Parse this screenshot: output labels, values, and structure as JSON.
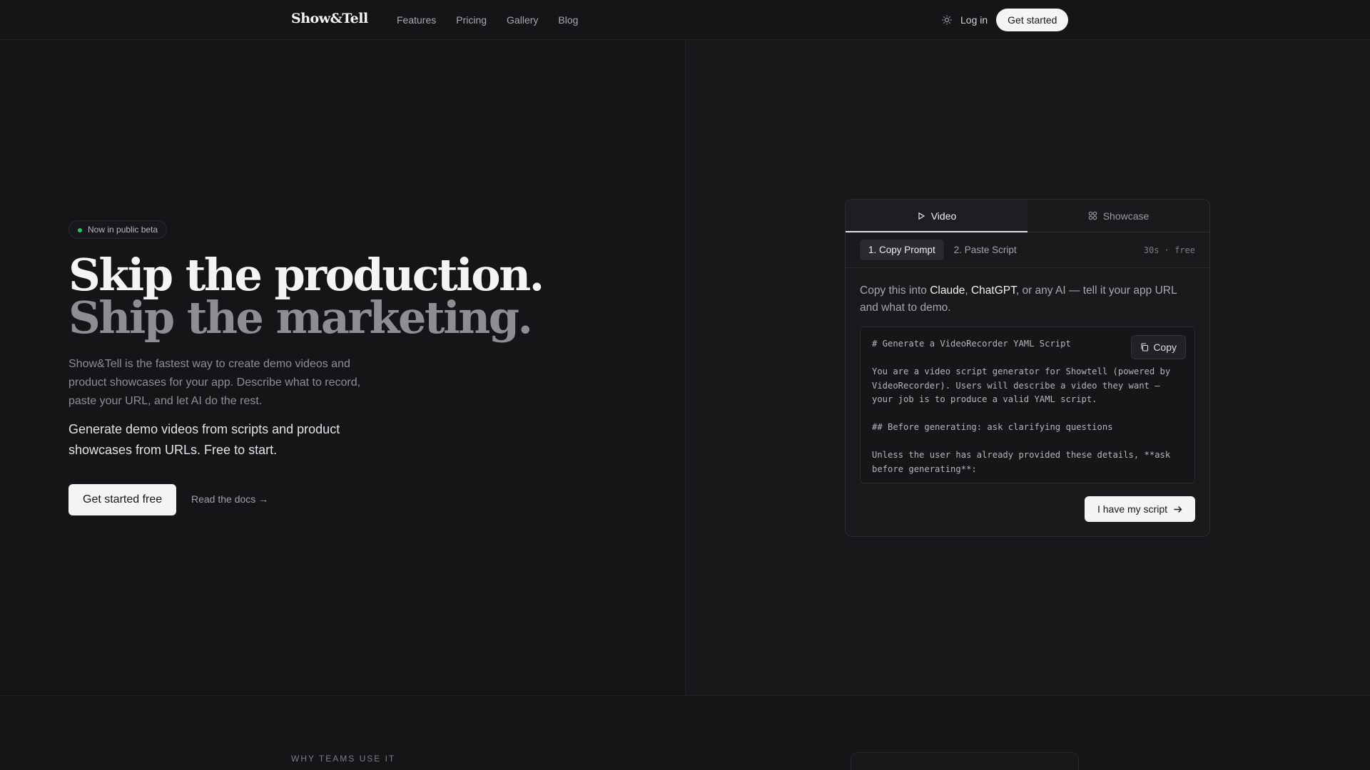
{
  "brand": "Show&Tell",
  "nav": [
    "Features",
    "Pricing",
    "Gallery",
    "Blog"
  ],
  "header": {
    "login": "Log in",
    "cta": "Get started"
  },
  "hero": {
    "badge": "Now in public beta",
    "headline_1": "Skip the production.",
    "headline_2": "Ship the marketing.",
    "subtitle": "Show&Tell is the fastest way to create demo videos and product showcases for your app. Describe what to record, paste your URL, and let AI do the rest.",
    "subtitle_2": "Generate demo videos from scripts and product showcases from URLs. Free to start.",
    "cta": "Get started free",
    "docs_link": "Read the docs →"
  },
  "card": {
    "tabs": [
      "Video",
      "Showcase"
    ],
    "steps": [
      "1. Copy Prompt",
      "2. Paste Script"
    ],
    "meta": "30s · free",
    "instr_pre": "Copy this into ",
    "instr_claude": "Claude",
    "instr_comma": ", ",
    "instr_chatgpt": "ChatGPT",
    "instr_post": ", or any AI — tell it your app URL and what to demo.",
    "code": "# Generate a VideoRecorder YAML Script\n\nYou are a video script generator for Showtell (powered by VideoRecorder). Users will describe a video they want — your job is to produce a valid YAML script.\n\n## Before generating: ask clarifying questions\n\nUnless the user has already provided these details, **ask before generating**:",
    "copy_label": "Copy",
    "script_button": "I have my script"
  },
  "section_label": "WHY TEAMS USE IT"
}
